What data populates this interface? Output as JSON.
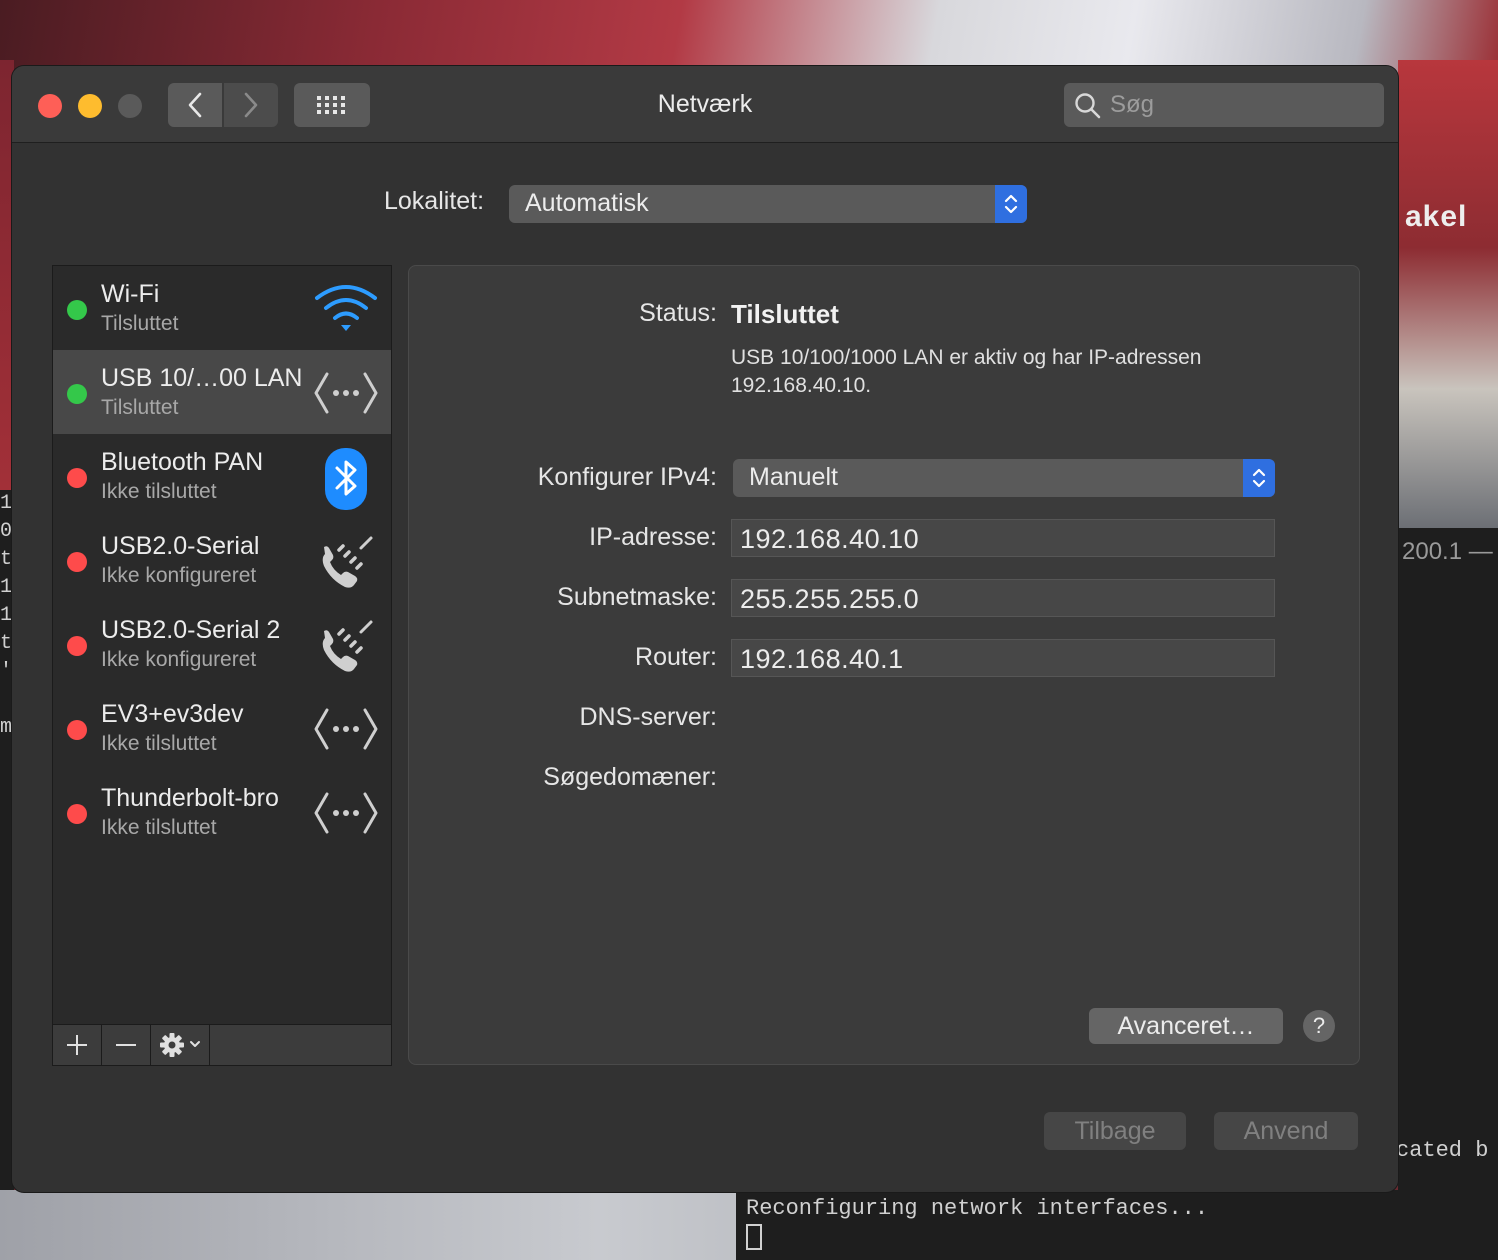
{
  "window": {
    "title": "Netværk",
    "search_placeholder": "Søg"
  },
  "location": {
    "label": "Lokalitet:",
    "value": "Automatisk"
  },
  "services": [
    {
      "name": "Wi-Fi",
      "state": "Tilsluttet",
      "status_color": "#34c84a",
      "icon": "wifi-icon",
      "selected": false
    },
    {
      "name": "USB 10/…00 LAN",
      "state": "Tilsluttet",
      "status_color": "#34c84a",
      "icon": "ethernet-icon",
      "selected": true
    },
    {
      "name": "Bluetooth PAN",
      "state": "Ikke tilsluttet",
      "status_color": "#fe4b4b",
      "icon": "bluetooth-icon",
      "selected": false
    },
    {
      "name": "USB2.0-Serial",
      "state": "Ikke konfigureret",
      "status_color": "#fe4b4b",
      "icon": "phone-modem-icon",
      "selected": false
    },
    {
      "name": "USB2.0-Serial 2",
      "state": "Ikke konfigureret",
      "status_color": "#fe4b4b",
      "icon": "phone-modem-icon",
      "selected": false
    },
    {
      "name": "EV3+ev3dev",
      "state": "Ikke tilsluttet",
      "status_color": "#fe4b4b",
      "icon": "ethernet-icon",
      "selected": false
    },
    {
      "name": "Thunderbolt-bro",
      "state": "Ikke tilsluttet",
      "status_color": "#fe4b4b",
      "icon": "ethernet-icon",
      "selected": false
    }
  ],
  "detail": {
    "status_label": "Status:",
    "status_value": "Tilsluttet",
    "status_description": "USB 10/100/1000 LAN er aktiv og har IP-adressen 192.168.40.10.",
    "ipv4_label": "Konfigurer IPv4:",
    "ipv4_value": "Manuelt",
    "ip_label": "IP-adresse:",
    "ip_value": "192.168.40.10",
    "subnet_label": "Subnetmaske:",
    "subnet_value": "255.255.255.0",
    "router_label": "Router:",
    "router_value": "192.168.40.1",
    "dns_label": "DNS-server:",
    "search_domains_label": "Søgedomæner:",
    "advanced_label": "Avanceret…",
    "help_label": "?"
  },
  "footer": {
    "revert_label": "Tilbage",
    "apply_label": "Anvend"
  },
  "background": {
    "terminal_line": "Reconfiguring network interfaces...",
    "right_ip_fragment": "200.1 —",
    "right_text_fragment": "cated b",
    "left_chars": [
      "1",
      "0",
      "t",
      "1",
      "1",
      "t",
      "'",
      "",
      "m"
    ],
    "logo_text": "akel"
  },
  "colors": {
    "accent": "#2f6fe0",
    "connected": "#34c84a",
    "disconnected": "#fe4b4b",
    "bluetooth": "#1e8cff",
    "wifi": "#2d9cff"
  }
}
